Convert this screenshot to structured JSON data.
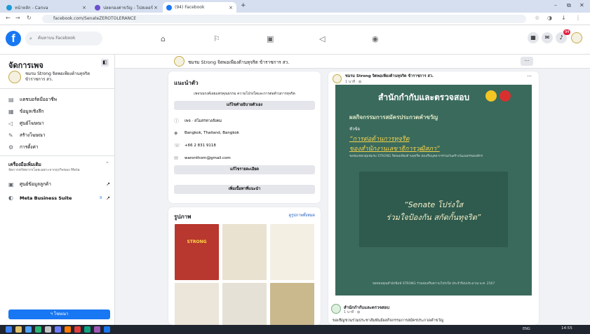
{
  "browser": {
    "tabs": [
      {
        "label": "หน้าหลัก - Canva",
        "color": "#1a9ad6"
      },
      {
        "label": "ปลดกองค่าขวัญ - โปสเตอร์",
        "color": "#6a4fcf"
      },
      {
        "label": "(94) Facebook",
        "color": "#1877f2"
      }
    ],
    "new_tab": "+",
    "url": "facebook.com/SenateZEROTOLERANCE",
    "window_controls": [
      "–",
      "⧉",
      "✕"
    ]
  },
  "facebook": {
    "search_placeholder": "ค้นหาบน Facebook",
    "notification_count": "94"
  },
  "sidebar": {
    "title": "จัดการเพจ",
    "page_name": "ชมรม Strong จิตพอเพียงต้านทุจริต ข้าราชการ สว.",
    "items": [
      {
        "label": "แดชบอร์ดมืออาชีพ",
        "icon": "▤"
      },
      {
        "label": "ข้อมูลเชิงลึก",
        "icon": "▦"
      },
      {
        "label": "ศูนย์โฆษณา",
        "icon": "◁"
      },
      {
        "label": "สร้างโฆษณา",
        "icon": "✎"
      },
      {
        "label": "การตั้งค่า",
        "icon": "⚙"
      }
    ],
    "tools_heading": "เครื่องมือเพิ่มเติม",
    "tools_sub": "จัดการทรัพยากรโดยเฉพาะจากธุรกิจของ Meta",
    "tool_items": [
      {
        "label": "ศูนย์ข้อมูลลูกค้า",
        "icon": "▣",
        "arrow": "↗"
      },
      {
        "label": "Meta Business Suite",
        "icon": "◐",
        "arrow": "↗",
        "badge": "9"
      }
    ],
    "promote_label": "ฯ โฆษณา"
  },
  "page_header": {
    "name": "ชมรม Strong จิตพอเพียงต้านทุจริต ข้าราชการ สว.",
    "more": "···"
  },
  "intro": {
    "title": "แนะนำตัว",
    "bio": "เพจรณรงค์เผยแพร่คุณธรรม ความโปร่งใสและการต่อต้านการทุจริต",
    "edit_bio": "แก้ไขคำอธิบายตัวเอง",
    "category": "เพจ · สโมสรทางสังคม",
    "location": "Bangkok, Thailand, Bangkok",
    "phone": "+66 2 831 9118",
    "email": "waronthorn@gmail.com",
    "edit_details": "แก้ไขรายละเอียด",
    "add_featured": "เพิ่มเนื้อหาที่แนะนำ"
  },
  "photos": {
    "title": "รูปภาพ",
    "see_all": "ดูรูปภาพทั้งหมด",
    "thumbs": [
      {
        "color": "#b8372e",
        "label": "STRONG"
      },
      {
        "color": "#e9e2d0",
        "label": ""
      },
      {
        "color": "#f3efe3",
        "label": ""
      },
      {
        "color": "#ece6da",
        "label": ""
      },
      {
        "color": "#e6e1d6",
        "label": ""
      },
      {
        "color": "#c9b98d",
        "label": ""
      }
    ]
  },
  "post": {
    "author": "ชมรม Strong จิตพอเพียงต้านทุจริต ข้าราชการ สว.",
    "time": "1 นาที · ◍",
    "more": "···",
    "poster_title": "สำนักกำกับและตรวจสอบ",
    "poster_sub": "ผลกิจกรรมการสมัครประกวดคำขวัญ",
    "poster_topic_label": "หัวข้อ",
    "poster_topic_1": "“การต่อต้านการทุจริต",
    "poster_topic_2": "ของสำนักงานเลขาธิการวุฒิสภา”",
    "poster_desc": "ขอชมเชยกลุ่มชมรม STRONG จิตพอเพียงต้านทุจริต ส่งเสริมบุคลากรร่วมกันสร้างวัฒนธรรมองค์กร",
    "slogan_1": "“Senate โปร่งใส",
    "slogan_2": "ร่วมใจป้องกัน สกัดกั้นทุจริต”",
    "poster_footer": "ขอขอบคุณสำนักพิมพ์ STRONG ร่วมส่งเสริมความโปร่งใส ประจำปีงบประมาณ พ.ศ. 2567",
    "shared_from": "สำนักกำกับและตรวจสอบ",
    "shared_time": "1 นาที · ◍",
    "caption": "ขอเชิญชวนร่วมประชาสัมพันธ์ผลกิจกรรมการสมัครประกวดคำขวัญ"
  },
  "taskbar": {
    "tray_lang": "ENG",
    "clock": "14:55"
  },
  "colors": {
    "fb_blue": "#1877f2",
    "poster_green": "#3a6a5c",
    "poster_inner": "#2f5a4e",
    "link_blue": "#1d5bbf"
  }
}
